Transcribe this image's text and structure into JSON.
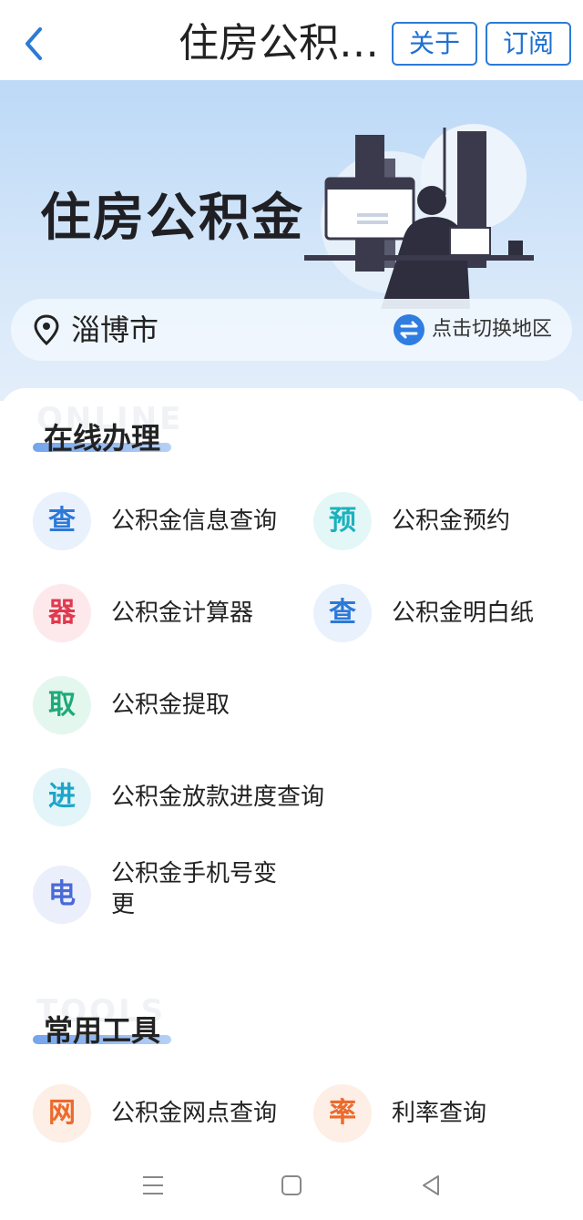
{
  "navbar": {
    "title": "住房公积金...",
    "about_label": "关于",
    "subscribe_label": "订阅"
  },
  "banner": {
    "title": "住房公积金",
    "city": "淄博市",
    "switch_label": "点击切换地区"
  },
  "sections": {
    "online": {
      "title": "在线办理",
      "ghost": "ONLINE",
      "items": [
        {
          "icon_char": "查",
          "label": "公积金信息查询"
        },
        {
          "icon_char": "预",
          "label": "公积金预约"
        },
        {
          "icon_char": "器",
          "label": "公积金计算器"
        },
        {
          "icon_char": "查",
          "label": "公积金明白纸"
        },
        {
          "icon_char": "取",
          "label": "公积金提取"
        },
        {
          "icon_char": "进",
          "label": "公积金放款进度查询"
        },
        {
          "icon_char": "电",
          "label": "公积金手机号变更"
        }
      ]
    },
    "tools": {
      "title": "常用工具",
      "ghost": "TOOLS",
      "items": [
        {
          "icon_char": "网",
          "label": "公积金网点查询"
        },
        {
          "icon_char": "率",
          "label": "利率查询"
        }
      ]
    }
  },
  "colors": {
    "accent": "#2c7ad6",
    "banner_top": "#bcd9f7"
  }
}
